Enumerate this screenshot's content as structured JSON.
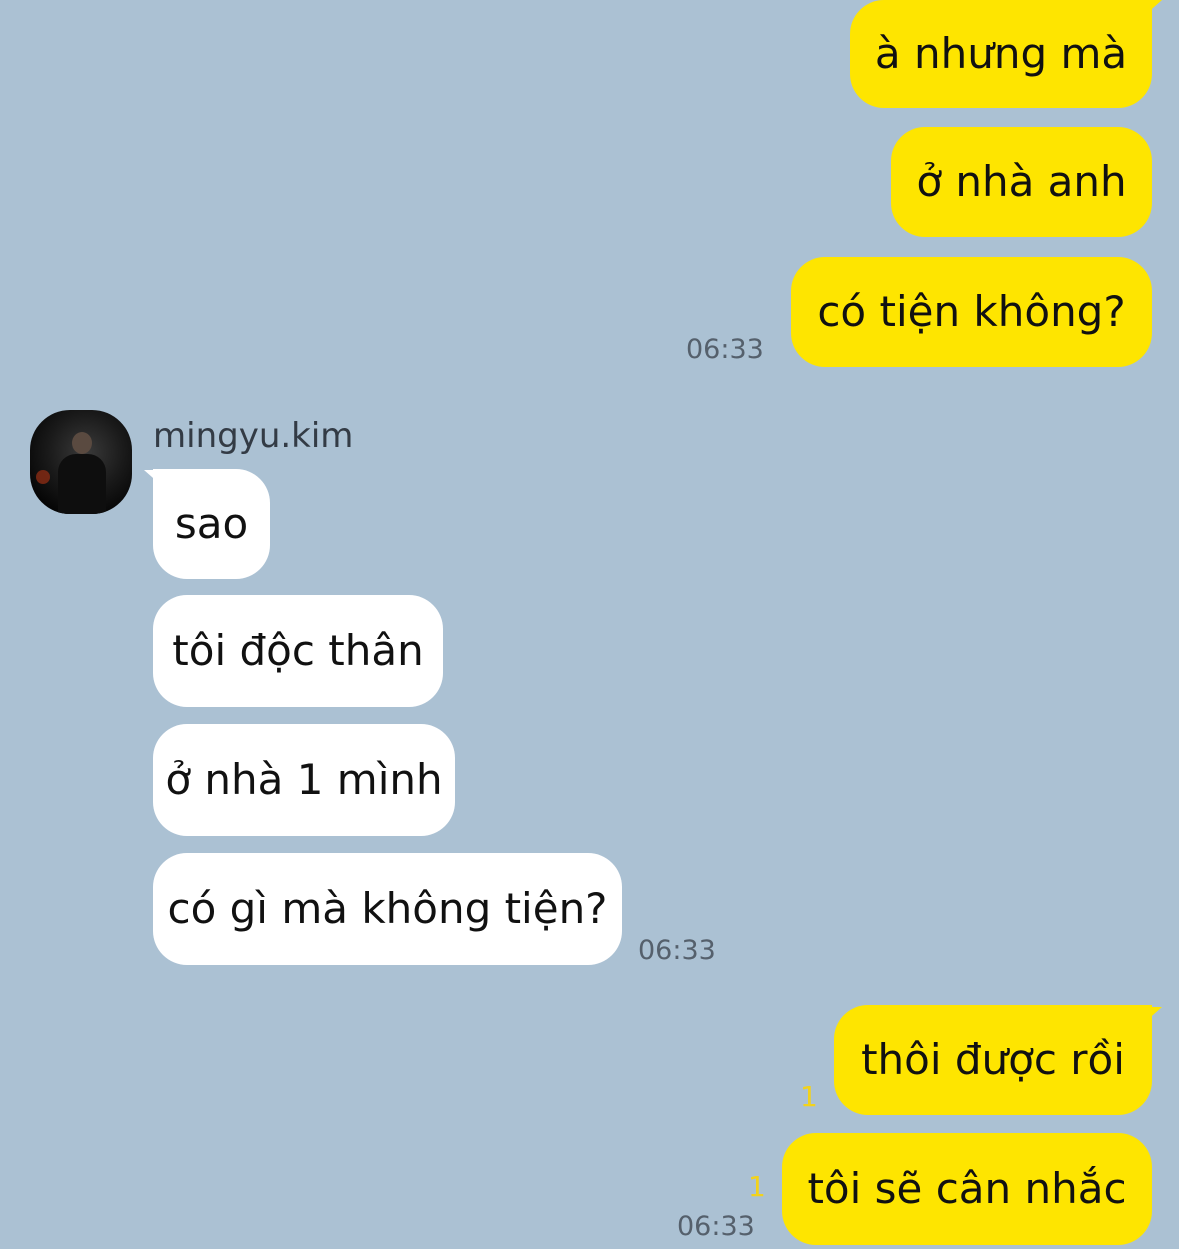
{
  "outgoing_group_1": {
    "messages": [
      "à nhưng mà",
      "ở nhà anh",
      "có tiện không?"
    ],
    "time": "06:33"
  },
  "incoming_group": {
    "sender": "mingyu.kim",
    "messages": [
      "sao",
      "tôi độc thân",
      "ở nhà 1 mình",
      "có gì mà không tiện?"
    ],
    "time": "06:33"
  },
  "outgoing_group_2": {
    "messages": [
      {
        "text": "thôi được rồi",
        "unread": "1"
      },
      {
        "text": "tôi sẽ cân nhắc",
        "unread": "1"
      }
    ],
    "time": "06:33"
  },
  "colors": {
    "background": "#abc1d3",
    "outgoing_bubble": "#fee500",
    "incoming_bubble": "#ffffff",
    "unread_count": "#f2d21b"
  }
}
